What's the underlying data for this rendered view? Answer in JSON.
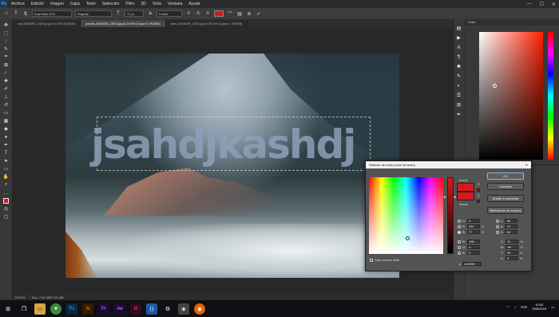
{
  "menubar": {
    "logo": "Ps",
    "items": [
      "Archivo",
      "Edición",
      "Imagen",
      "Capa",
      "Texto",
      "Selección",
      "Filtro",
      "3D",
      "Vista",
      "Ventana",
      "Ayuda"
    ],
    "window_controls": [
      "—",
      "☐",
      "✕"
    ]
  },
  "options_bar": {
    "font_family": "Erse Bold STC",
    "font_style": "Regular",
    "font_size": "72 pt",
    "antialias": "Fuerte",
    "text_color": "#d7191f"
  },
  "tabs": [
    {
      "label": "cat-2528855_1920.jpg al 34,5% (RGB/8)",
      "active": false
    },
    {
      "label": "pacific-4430530_1920.jpg al 19,6% (Capa 0, RGB/8)",
      "active": true
    },
    {
      "label": "pelo-4415649_1920.jpg al 66,5% (Capa 0, RGB/8)",
      "active": false
    }
  ],
  "canvas": {
    "typed_text": "jsahdjkashdj"
  },
  "status": {
    "zoom": "19,63%",
    "doc_size": "Doc: 7,91 MB/7,91 MB"
  },
  "color_panel": {
    "title": "Color"
  },
  "color_picker": {
    "title": "Selector de color (color de texto)",
    "close": "✕",
    "new_label": "nuevo",
    "current_label": "actual",
    "buttons": {
      "ok": "OK",
      "cancel": "Cancelar",
      "add_swatches": "Añadir a muestras",
      "color_libraries": "Bibliotecas de colores"
    },
    "web_colors_only": "Solo colores Web",
    "hsb": [
      {
        "label": "H:",
        "value": "0",
        "unit": "°"
      },
      {
        "label": "S:",
        "value": "100",
        "unit": "%"
      },
      {
        "label": "B:",
        "value": "77",
        "unit": "%"
      }
    ],
    "rgb": [
      {
        "label": "R:",
        "value": "196",
        "unit": ""
      },
      {
        "label": "G:",
        "value": "0",
        "unit": ""
      },
      {
        "label": "B:",
        "value": "0",
        "unit": ""
      }
    ],
    "lab": [
      {
        "label": "L:",
        "value": "46",
        "unit": ""
      },
      {
        "label": "a:",
        "value": "73",
        "unit": ""
      },
      {
        "label": "b:",
        "value": "64",
        "unit": ""
      }
    ],
    "cmyk": [
      {
        "label": "C:",
        "value": "11",
        "unit": "%"
      },
      {
        "label": "M:",
        "value": "99",
        "unit": "%"
      },
      {
        "label": "Y:",
        "value": "99",
        "unit": "%"
      },
      {
        "label": "K:",
        "value": "3",
        "unit": "%"
      }
    ],
    "hex_label": "#",
    "hex_value": "c40000"
  },
  "taskbar": {
    "time": "10:02",
    "date": "30/8/2019",
    "language": "ESP"
  }
}
